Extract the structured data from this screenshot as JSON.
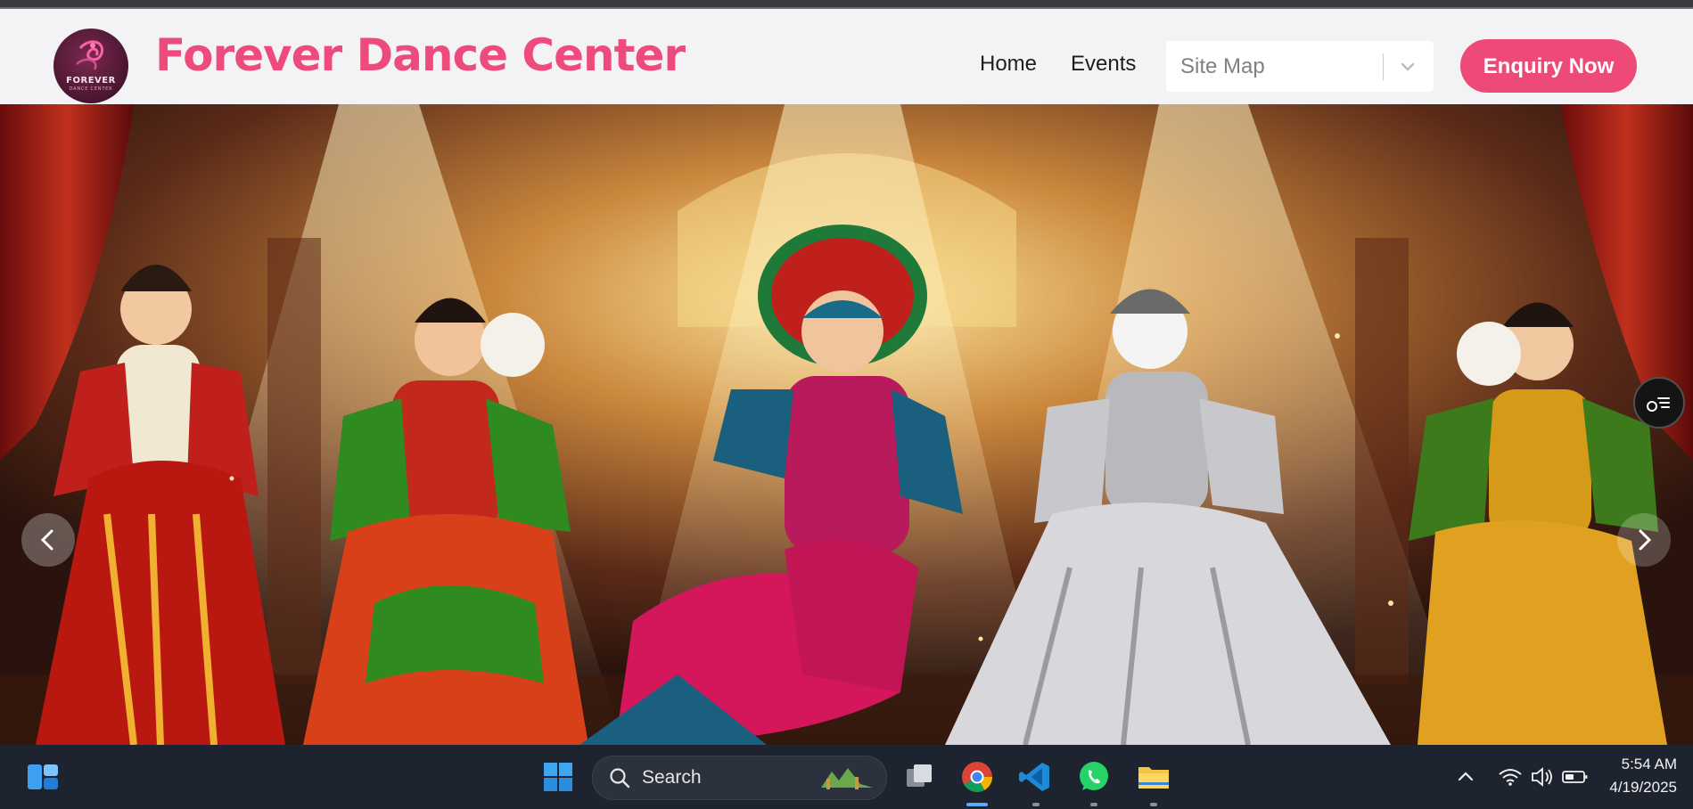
{
  "header": {
    "logo_text": "FOREVER",
    "logo_subtext": "DANCE CENTER",
    "brand_title": "Forever Dance Center",
    "nav": [
      "Home",
      "Events"
    ],
    "site_map_select": {
      "value": "Site Map"
    },
    "enquiry_button": "Enquiry Now",
    "brand_color": "#ee4b7d"
  },
  "hero": {
    "carousel_prev_icon": "chevron-left-icon",
    "carousel_next_icon": "chevron-right-icon",
    "floating_button_icon": "list-toggle-icon"
  },
  "taskbar": {
    "search_label": "Search",
    "apps": [
      "widgets-icon",
      "windows-start-icon",
      "task-view-icon",
      "chrome-icon",
      "vscode-icon",
      "whatsapp-icon",
      "file-explorer-icon"
    ],
    "tray_icons": [
      "chevron-up-icon",
      "wifi-icon",
      "volume-icon",
      "battery-icon"
    ],
    "time": "5:54 AM",
    "date": "4/19/2025"
  }
}
